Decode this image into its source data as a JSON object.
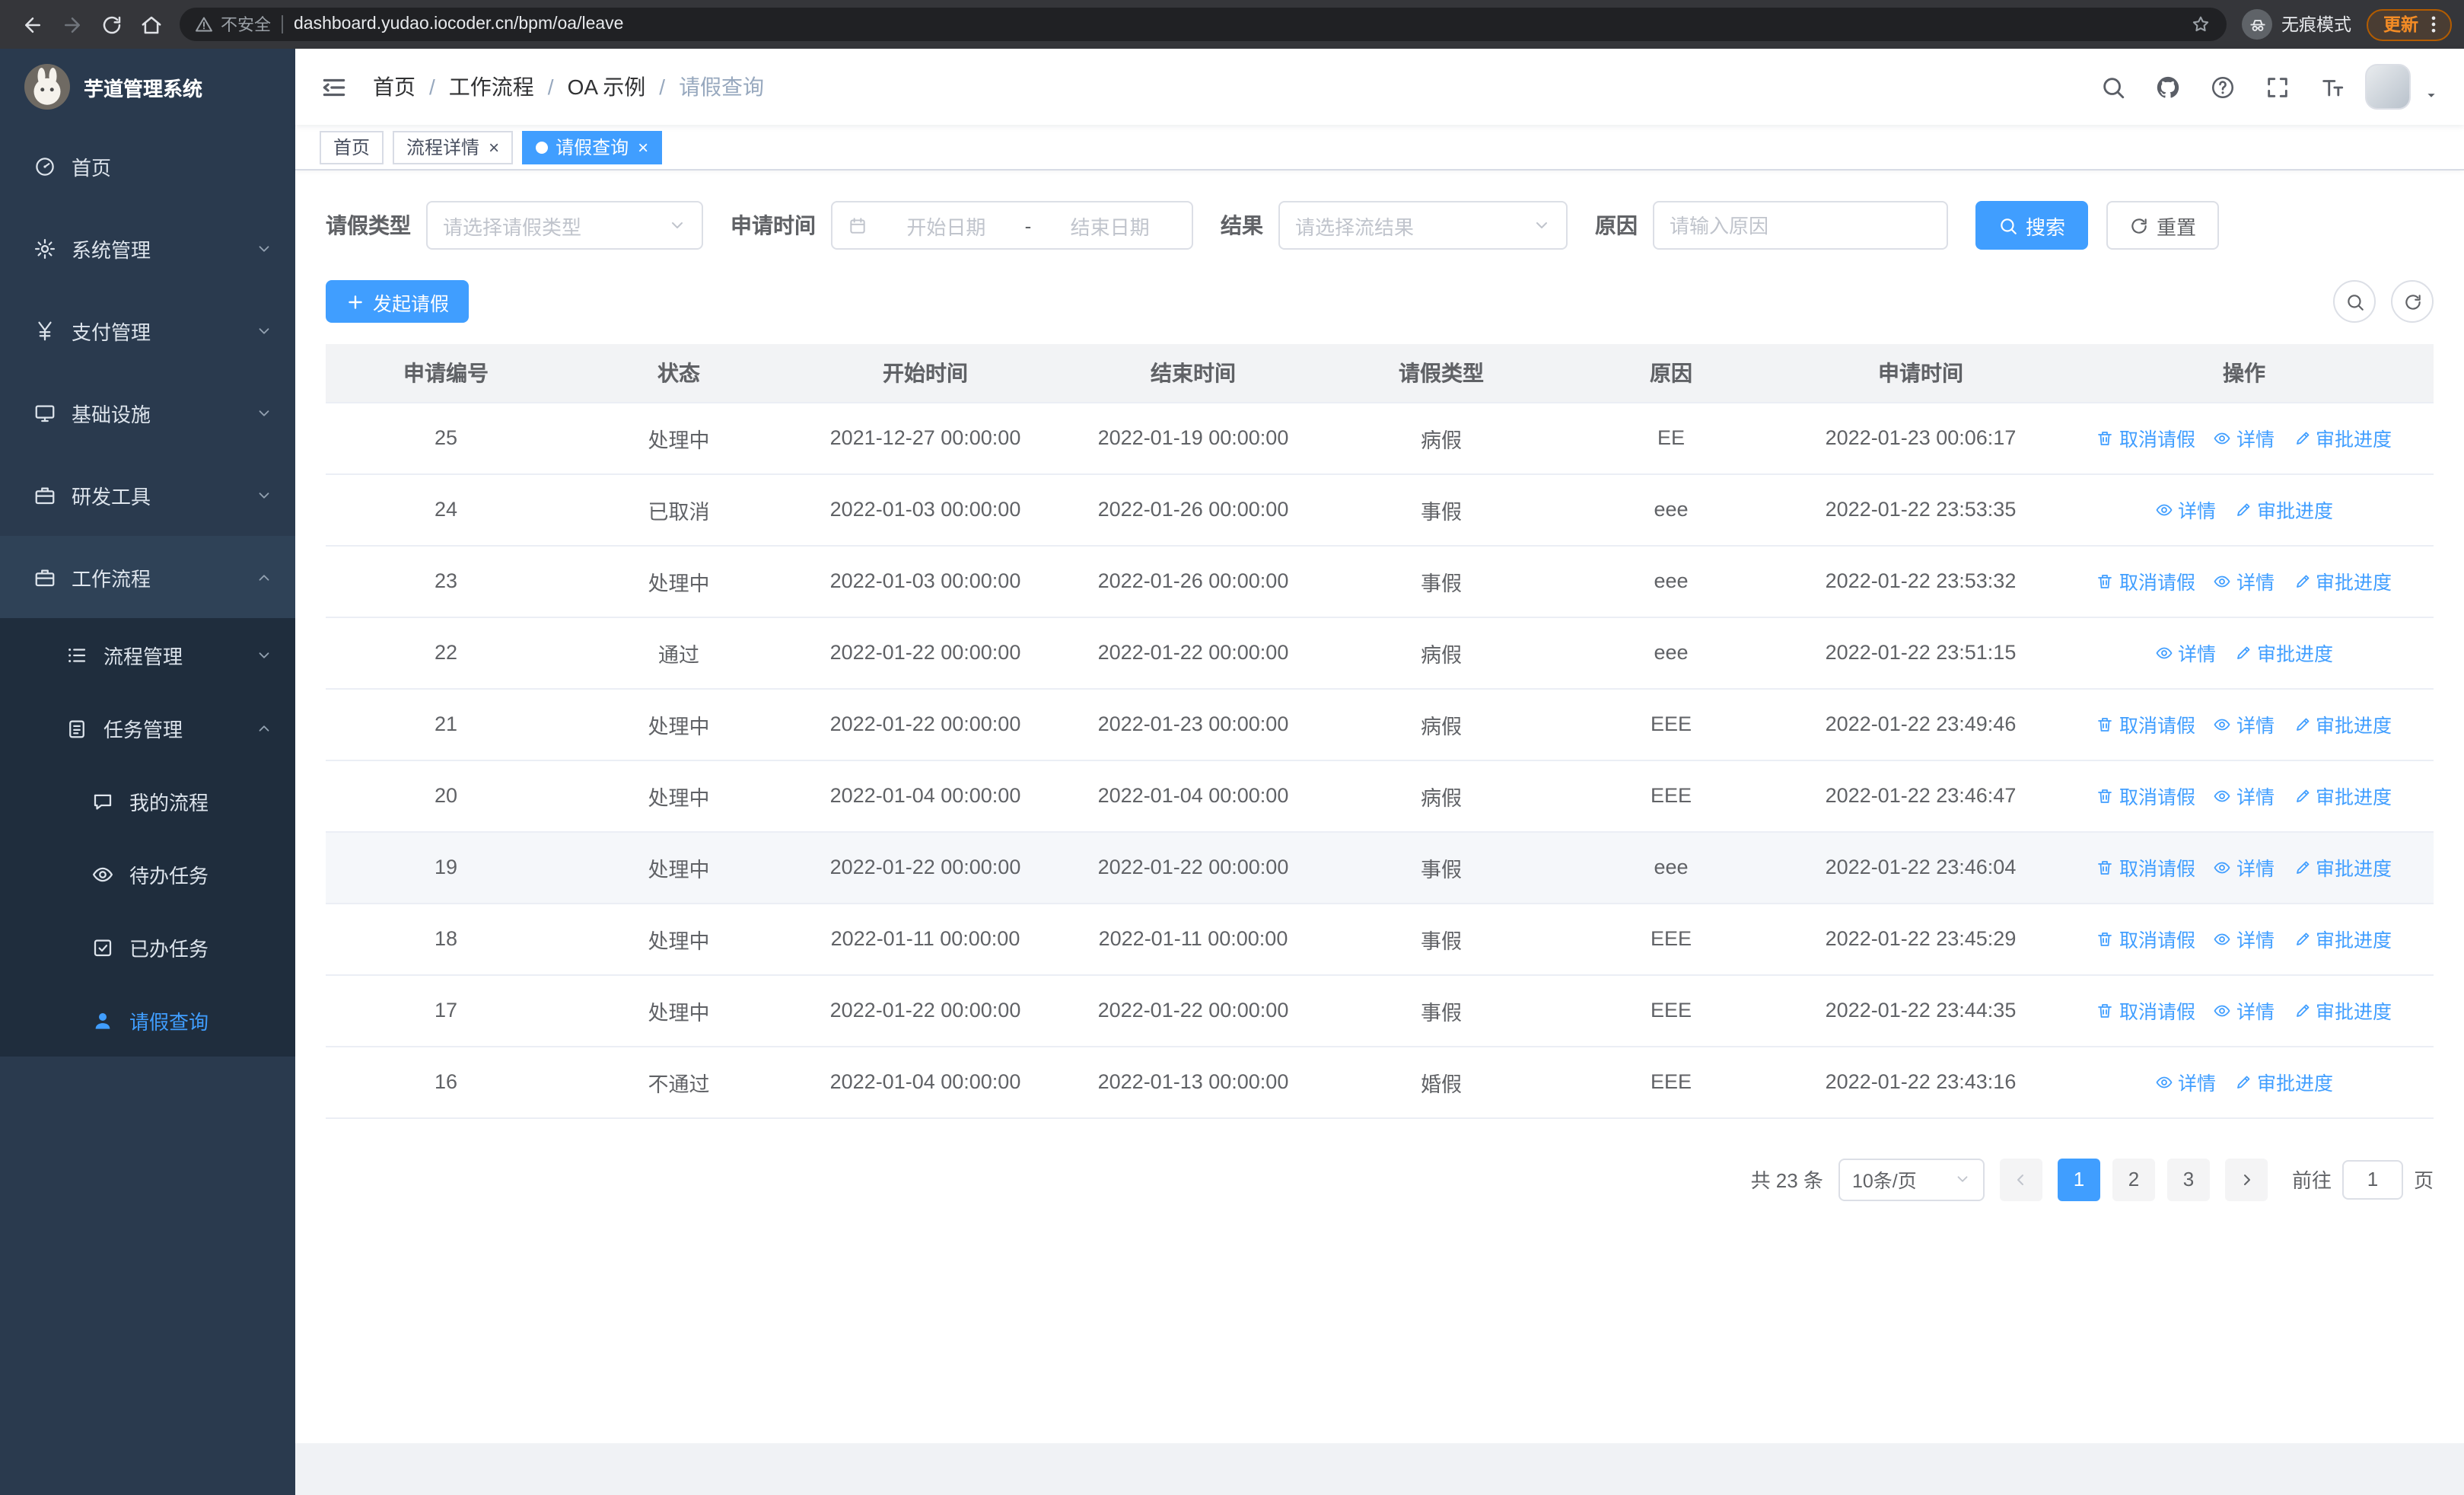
{
  "browser": {
    "security_label": "不安全",
    "url": "dashboard.yudao.iocoder.cn/bpm/oa/leave",
    "incognito_label": "无痕模式",
    "update_label": "更新"
  },
  "sidebar": {
    "logo_title": "芋道管理系统",
    "items": [
      {
        "name": "home",
        "label": "首页",
        "icon": "dash",
        "level": 1
      },
      {
        "name": "system-mgmt",
        "label": "系统管理",
        "icon": "gear",
        "level": 1,
        "chevron": "down"
      },
      {
        "name": "pay-mgmt",
        "label": "支付管理",
        "icon": "yen",
        "level": 1,
        "chevron": "down"
      },
      {
        "name": "infrastructure",
        "label": "基础设施",
        "icon": "monitor",
        "level": 1,
        "chevron": "down"
      },
      {
        "name": "dev-tools",
        "label": "研发工具",
        "icon": "case",
        "level": 1,
        "chevron": "down"
      },
      {
        "name": "workflow",
        "label": "工作流程",
        "icon": "case",
        "level": 1,
        "chevron": "up",
        "highlighted": true
      },
      {
        "name": "process-mgmt",
        "label": "流程管理",
        "icon": "list",
        "level": 2,
        "chevron": "down"
      },
      {
        "name": "task-mgmt",
        "label": "任务管理",
        "icon": "clip",
        "level": 2,
        "chevron": "up"
      },
      {
        "name": "my-process",
        "label": "我的流程",
        "icon": "chat",
        "level": 3
      },
      {
        "name": "todo-task",
        "label": "待办任务",
        "icon": "eye",
        "level": 3
      },
      {
        "name": "done-task",
        "label": "已办任务",
        "icon": "check",
        "level": 3
      },
      {
        "name": "leave-query",
        "label": "请假查询",
        "icon": "user",
        "level": 3,
        "active": true
      }
    ]
  },
  "header": {
    "breadcrumb": [
      "首页",
      "工作流程",
      "OA 示例",
      "请假查询"
    ]
  },
  "tabs": [
    {
      "label": "首页",
      "active": false,
      "closable": false
    },
    {
      "label": "流程详情",
      "active": false,
      "closable": true
    },
    {
      "label": "请假查询",
      "active": true,
      "closable": true
    }
  ],
  "filters": {
    "leave_type_label": "请假类型",
    "leave_type_placeholder": "请选择请假类型",
    "apply_time_label": "申请时间",
    "start_placeholder": "开始日期",
    "range_separator": "-",
    "end_placeholder": "结束日期",
    "result_label": "结果",
    "result_placeholder": "请选择流结果",
    "reason_label": "原因",
    "reason_placeholder": "请输入原因",
    "search_label": "搜索",
    "reset_label": "重置"
  },
  "toolbar": {
    "create_label": "发起请假"
  },
  "table": {
    "columns": [
      "申请编号",
      "状态",
      "开始时间",
      "结束时间",
      "请假类型",
      "原因",
      "申请时间",
      "操作"
    ],
    "actions": {
      "cancel": "取消请假",
      "detail": "详情",
      "progress": "审批进度"
    },
    "rows": [
      {
        "id": "25",
        "status": "处理中",
        "start": "2021-12-27 00:00:00",
        "end": "2022-01-19 00:00:00",
        "type": "病假",
        "reason": "EE",
        "applied": "2022-01-23 00:06:17",
        "can_cancel": true,
        "hover": false
      },
      {
        "id": "24",
        "status": "已取消",
        "start": "2022-01-03 00:00:00",
        "end": "2022-01-26 00:00:00",
        "type": "事假",
        "reason": "eee",
        "applied": "2022-01-22 23:53:35",
        "can_cancel": false,
        "hover": false
      },
      {
        "id": "23",
        "status": "处理中",
        "start": "2022-01-03 00:00:00",
        "end": "2022-01-26 00:00:00",
        "type": "事假",
        "reason": "eee",
        "applied": "2022-01-22 23:53:32",
        "can_cancel": true,
        "hover": false
      },
      {
        "id": "22",
        "status": "通过",
        "start": "2022-01-22 00:00:00",
        "end": "2022-01-22 00:00:00",
        "type": "病假",
        "reason": "eee",
        "applied": "2022-01-22 23:51:15",
        "can_cancel": false,
        "hover": false
      },
      {
        "id": "21",
        "status": "处理中",
        "start": "2022-01-22 00:00:00",
        "end": "2022-01-23 00:00:00",
        "type": "病假",
        "reason": "EEE",
        "applied": "2022-01-22 23:49:46",
        "can_cancel": true,
        "hover": false
      },
      {
        "id": "20",
        "status": "处理中",
        "start": "2022-01-04 00:00:00",
        "end": "2022-01-04 00:00:00",
        "type": "病假",
        "reason": "EEE",
        "applied": "2022-01-22 23:46:47",
        "can_cancel": true,
        "hover": false
      },
      {
        "id": "19",
        "status": "处理中",
        "start": "2022-01-22 00:00:00",
        "end": "2022-01-22 00:00:00",
        "type": "事假",
        "reason": "eee",
        "applied": "2022-01-22 23:46:04",
        "can_cancel": true,
        "hover": true
      },
      {
        "id": "18",
        "status": "处理中",
        "start": "2022-01-11 00:00:00",
        "end": "2022-01-11 00:00:00",
        "type": "事假",
        "reason": "EEE",
        "applied": "2022-01-22 23:45:29",
        "can_cancel": true,
        "hover": false
      },
      {
        "id": "17",
        "status": "处理中",
        "start": "2022-01-22 00:00:00",
        "end": "2022-01-22 00:00:00",
        "type": "事假",
        "reason": "EEE",
        "applied": "2022-01-22 23:44:35",
        "can_cancel": true,
        "hover": false
      },
      {
        "id": "16",
        "status": "不通过",
        "start": "2022-01-04 00:00:00",
        "end": "2022-01-13 00:00:00",
        "type": "婚假",
        "reason": "EEE",
        "applied": "2022-01-22 23:43:16",
        "can_cancel": false,
        "hover": false
      }
    ]
  },
  "pagination": {
    "total": "共 23 条",
    "page_size": "10条/页",
    "pages": [
      "1",
      "2",
      "3"
    ],
    "active_page": "1",
    "goto_label": "前往",
    "goto_value": "1",
    "goto_suffix": "页"
  },
  "colors": {
    "accent": "#409eff",
    "sidebar_bg": "#2a3a4e",
    "submenu_bg": "#1f2d3d",
    "header_bg": "#f2f3f5"
  }
}
